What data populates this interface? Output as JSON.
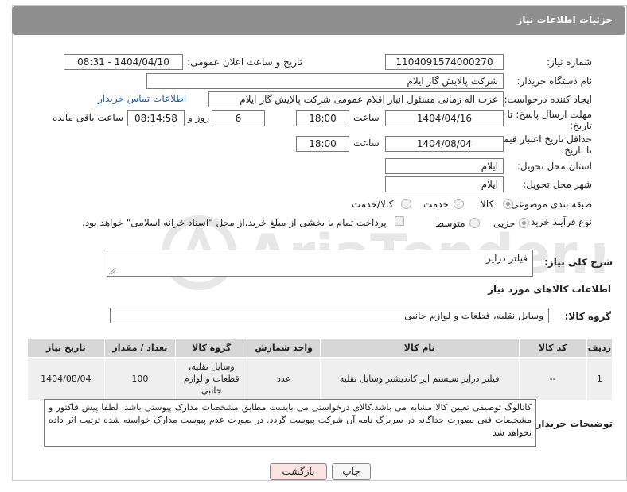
{
  "header": {
    "title": "جزئیات اطلاعات نیاز"
  },
  "fields": {
    "need_number_label": "شماره نیاز:",
    "need_number": "1104091574000270",
    "announce_label": "تاریخ و ساعت اعلان عمومی:",
    "announce_value": "1404/04/10 - 08:31",
    "buyer_org_label": "نام دستگاه خریدار:",
    "buyer_org": "شرکت پالایش گاز ایلام",
    "requester_label": "ایجاد کننده درخواست:",
    "requester": "عزت اله زمانی مسئول انبار اقلام عمومی شرکت پالایش گاز ایلام",
    "contact_link": "اطلاعات تماس خریدار",
    "deadline_label_1": "مهلت ارسال پاسخ: تا",
    "deadline_label_2": "تاریخ:",
    "deadline_date": "1404/04/16",
    "time_label": "ساعت",
    "deadline_time": "18:00",
    "days_value": "6",
    "days_label": "روز و",
    "remaining_time": "08:14:58",
    "remaining_label": "ساعت باقی مانده",
    "price_label_1": "حداقل تاریخ اعتبار قیمت:",
    "price_label_2": "تا تاریخ:",
    "price_date": "1404/08/04",
    "price_time": "18:00",
    "province_label": "استان محل تحویل:",
    "province": "ایلام",
    "city_label": "شهر محل تحویل:",
    "city": "ایلام",
    "category_label": "طبقه بندی موضوعی:",
    "category_options": [
      "کالا",
      "خدمت",
      "کالا/خدمت"
    ],
    "process_label": "نوع فرآیند خرید :",
    "process_options": [
      "جزیی",
      "متوسط"
    ],
    "payment_note": "پرداخت تمام یا بخشی از مبلغ خرید،از محل \"اسناد خزانه اسلامی\" خواهد بود.",
    "summary_label": "شرح کلی نیاز:",
    "summary": "فیلتر درایر",
    "goods_info_title": "اطلاعات کالاهای مورد نیاز",
    "goods_group_label": "گروه کالا:",
    "goods_group": "وسایل نقلیه، قطعات و لوازم جانبی"
  },
  "table": {
    "headers": [
      "ردیف",
      "کد کالا",
      "نام کالا",
      "واحد شمارش",
      "گروه کالا",
      "تعداد / مقدار",
      "تاریخ نیاز"
    ],
    "rows": [
      [
        "1",
        "--",
        "فیلتر درایر سیستم ایر کاندیشنر وسایل نقلیه",
        "عدد",
        "وسایل نقلیه، قطعات و لوازم جانبی",
        "100",
        "1404/08/04"
      ]
    ]
  },
  "buyer_notes_label": "توضیحات خریدار:",
  "buyer_notes": "کاتالوگ توصیفی تعیین کالا مشابه می باشد.کالای درخواستی می بایست مطابق مشخصات مدارک پیوستی باشد. لطفا پیش فاکتور و مشخصات فنی بصورت جداگانه  در سربرگ نامه آن شرکت پیوست گردد. در صورت عدم پیوست مدارک خواسته شده ترتیب اثر داده نخواهد شد",
  "buttons": {
    "print": "چاپ",
    "back": "بازگشت"
  },
  "watermark": "AriaTender.net",
  "colors": {
    "header_bg": "#8e8e8e",
    "link": "#1a5fb4",
    "back_btn_bg": "#fbe3e3"
  }
}
